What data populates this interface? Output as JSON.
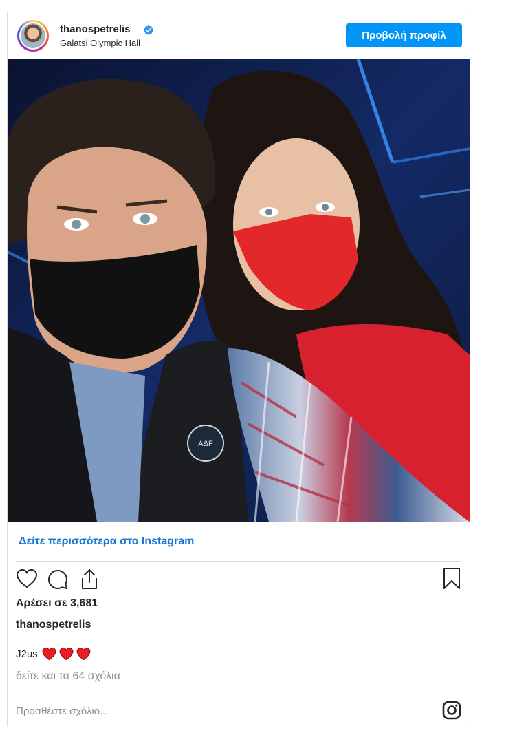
{
  "post": {
    "username": "thanospetrelis",
    "location": "Galatsi Olympic Hall",
    "profile_button_label": "Προβολή προφίλ",
    "see_more_label": "Δείτε περισσότερα στο Instagram",
    "likes_text": "Αρέσει σε 3,681",
    "caption_owner": "thanospetrelis",
    "caption_text": "J2us",
    "caption_emojis": [
      "heart",
      "heart",
      "heart"
    ],
    "view_comments_label": "δείτε και τα 64 σχόλια",
    "comment_placeholder": "Προσθέστε σχόλιο..."
  },
  "icons": {
    "verified": "verified-badge-icon",
    "like": "heart-outline-icon",
    "comment": "comment-bubble-icon",
    "share": "share-upload-icon",
    "save": "bookmark-icon",
    "instagram": "instagram-logo-icon"
  },
  "colors": {
    "accent": "#0095f6",
    "link": "#1877d6",
    "heart": "#ed1c24",
    "muted": "#8e8e8e",
    "border": "#dbdbdb"
  }
}
